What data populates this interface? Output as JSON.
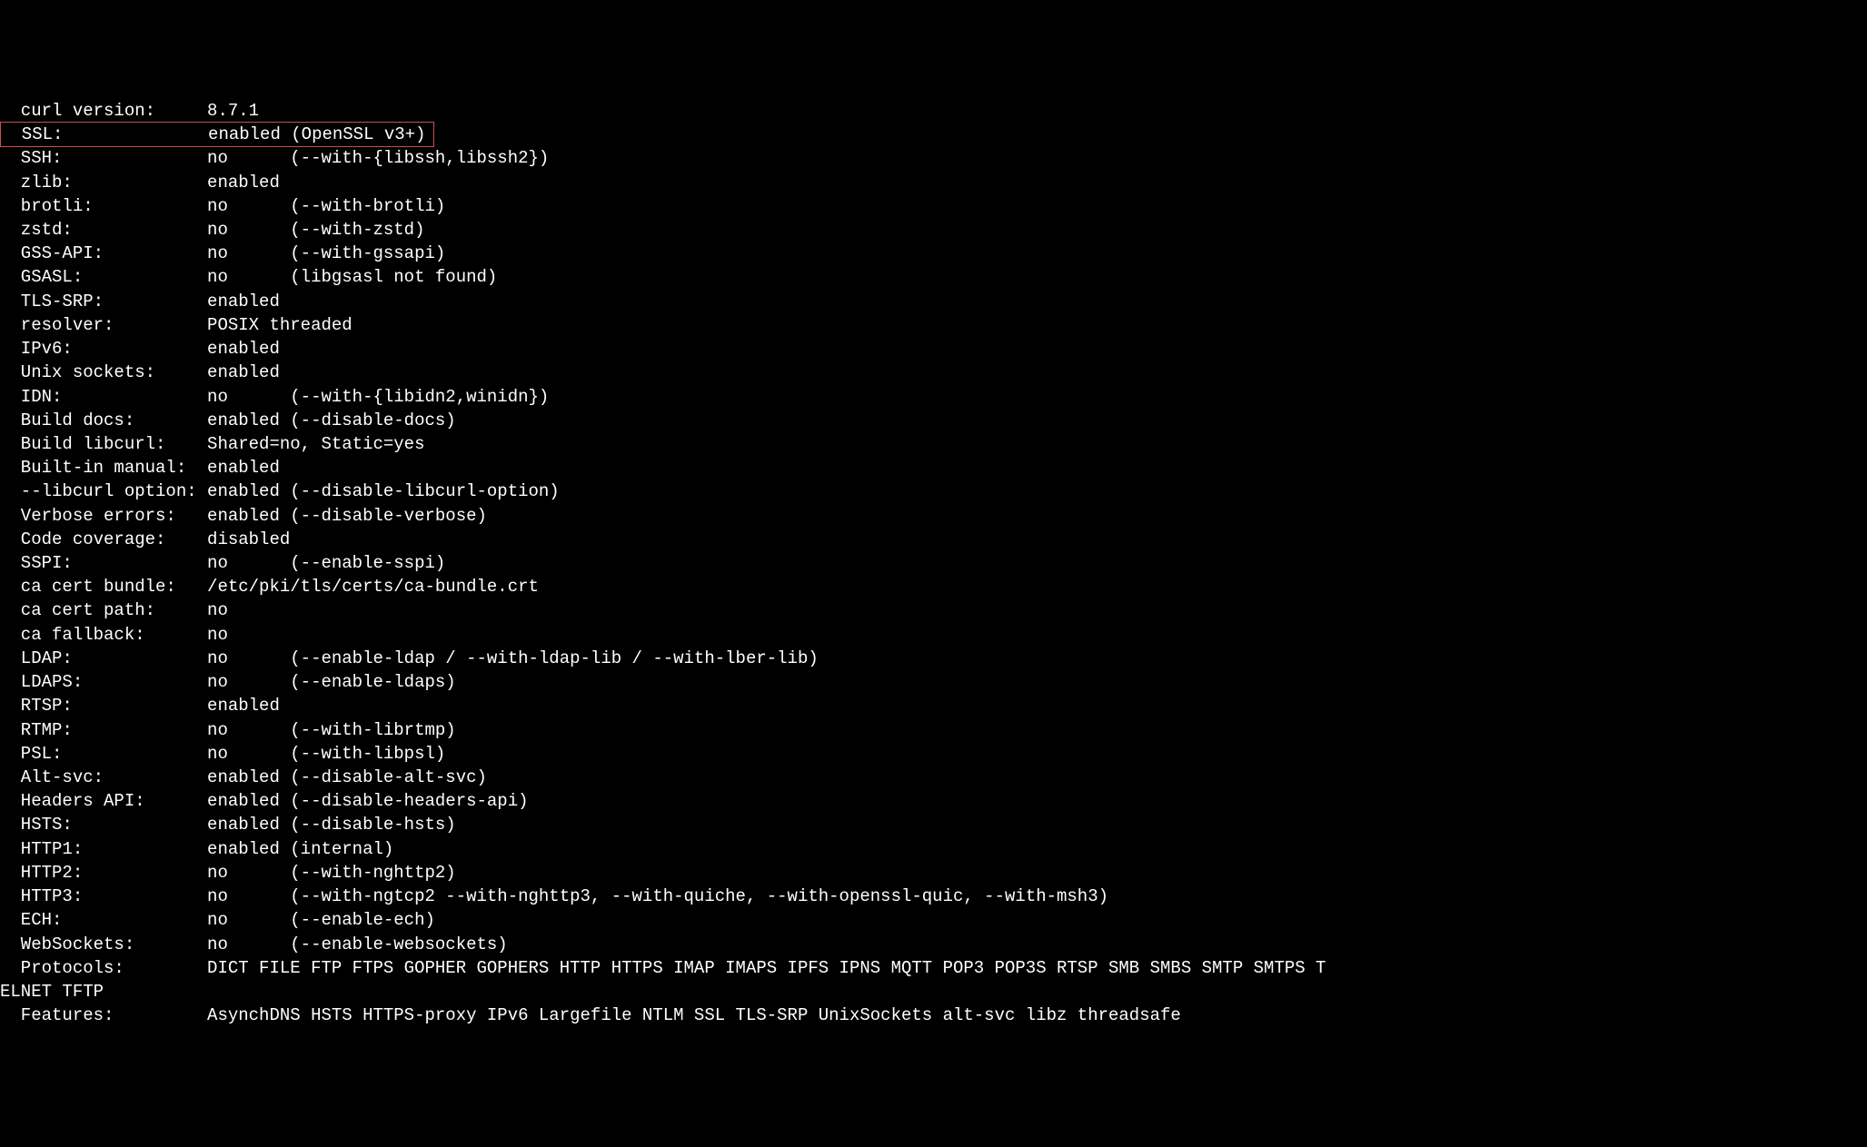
{
  "config_rows": [
    {
      "key": "curl version:",
      "value": "8.7.1",
      "highlighted": false
    },
    {
      "key": "SSL:",
      "value": "enabled (OpenSSL v3+)",
      "highlighted": true
    },
    {
      "key": "SSH:",
      "value": "no      (--with-{libssh,libssh2})",
      "highlighted": false
    },
    {
      "key": "zlib:",
      "value": "enabled",
      "highlighted": false
    },
    {
      "key": "brotli:",
      "value": "no      (--with-brotli)",
      "highlighted": false
    },
    {
      "key": "zstd:",
      "value": "no      (--with-zstd)",
      "highlighted": false
    },
    {
      "key": "GSS-API:",
      "value": "no      (--with-gssapi)",
      "highlighted": false
    },
    {
      "key": "GSASL:",
      "value": "no      (libgsasl not found)",
      "highlighted": false
    },
    {
      "key": "TLS-SRP:",
      "value": "enabled",
      "highlighted": false
    },
    {
      "key": "resolver:",
      "value": "POSIX threaded",
      "highlighted": false
    },
    {
      "key": "IPv6:",
      "value": "enabled",
      "highlighted": false
    },
    {
      "key": "Unix sockets:",
      "value": "enabled",
      "highlighted": false
    },
    {
      "key": "IDN:",
      "value": "no      (--with-{libidn2,winidn})",
      "highlighted": false
    },
    {
      "key": "Build docs:",
      "value": "enabled (--disable-docs)",
      "highlighted": false
    },
    {
      "key": "Build libcurl:",
      "value": "Shared=no, Static=yes",
      "highlighted": false
    },
    {
      "key": "Built-in manual:",
      "value": "enabled",
      "highlighted": false
    },
    {
      "key": "--libcurl option:",
      "value": "enabled (--disable-libcurl-option)",
      "highlighted": false
    },
    {
      "key": "Verbose errors:",
      "value": "enabled (--disable-verbose)",
      "highlighted": false
    },
    {
      "key": "Code coverage:",
      "value": "disabled",
      "highlighted": false
    },
    {
      "key": "SSPI:",
      "value": "no      (--enable-sspi)",
      "highlighted": false
    },
    {
      "key": "ca cert bundle:",
      "value": "/etc/pki/tls/certs/ca-bundle.crt",
      "highlighted": false
    },
    {
      "key": "ca cert path:",
      "value": "no",
      "highlighted": false
    },
    {
      "key": "ca fallback:",
      "value": "no",
      "highlighted": false
    },
    {
      "key": "LDAP:",
      "value": "no      (--enable-ldap / --with-ldap-lib / --with-lber-lib)",
      "highlighted": false
    },
    {
      "key": "LDAPS:",
      "value": "no      (--enable-ldaps)",
      "highlighted": false
    },
    {
      "key": "RTSP:",
      "value": "enabled",
      "highlighted": false
    },
    {
      "key": "RTMP:",
      "value": "no      (--with-librtmp)",
      "highlighted": false
    },
    {
      "key": "PSL:",
      "value": "no      (--with-libpsl)",
      "highlighted": false
    },
    {
      "key": "Alt-svc:",
      "value": "enabled (--disable-alt-svc)",
      "highlighted": false
    },
    {
      "key": "Headers API:",
      "value": "enabled (--disable-headers-api)",
      "highlighted": false
    },
    {
      "key": "HSTS:",
      "value": "enabled (--disable-hsts)",
      "highlighted": false
    },
    {
      "key": "HTTP1:",
      "value": "enabled (internal)",
      "highlighted": false
    },
    {
      "key": "HTTP2:",
      "value": "no      (--with-nghttp2)",
      "highlighted": false
    },
    {
      "key": "HTTP3:",
      "value": "no      (--with-ngtcp2 --with-nghttp3, --with-quiche, --with-openssl-quic, --with-msh3)",
      "highlighted": false
    },
    {
      "key": "ECH:",
      "value": "no      (--enable-ech)",
      "highlighted": false
    },
    {
      "key": "WebSockets:",
      "value": "no      (--enable-websockets)",
      "highlighted": false
    }
  ],
  "protocols": {
    "key": "Protocols:",
    "value_line1": "DICT FILE FTP FTPS GOPHER GOPHERS HTTP HTTPS IMAP IMAPS IPFS IPNS MQTT POP3 POP3S RTSP SMB SMBS SMTP SMTPS T",
    "value_line2": "ELNET TFTP"
  },
  "features": {
    "key": "Features:",
    "value": "AsynchDNS HSTS HTTPS-proxy IPv6 Largefile NTLM SSL TLS-SRP UnixSockets alt-svc libz threadsafe"
  },
  "layout": {
    "key_col_width": 18,
    "indent": "  "
  }
}
